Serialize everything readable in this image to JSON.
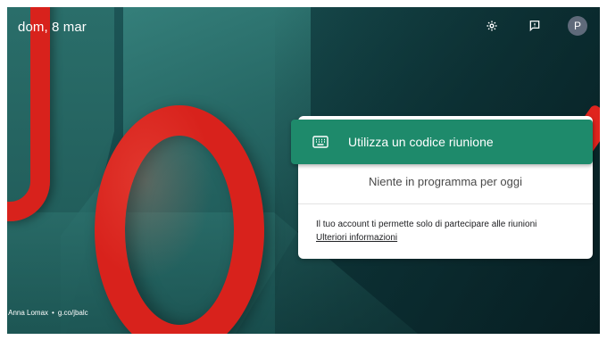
{
  "header": {
    "date": "dom, 8 mar",
    "avatar_letter": "P"
  },
  "icons": {
    "settings": "gear-icon",
    "feedback": "feedback-icon",
    "keyboard": "keyboard-icon"
  },
  "panel": {
    "join_label": "Utilizza un codice riunione",
    "nothing_scheduled": "Niente in programma per oggi",
    "account_info": "Il tuo account ti permette solo di partecipare alle riunioni",
    "more_info_link": "Ulteriori informazioni"
  },
  "credit": {
    "author": "& Anna Lomax",
    "separator": "•",
    "link": "g.co/jbalc"
  },
  "colors": {
    "accent": "#1e8a6b",
    "ring": "#d8221c",
    "avatar_bg": "#5f6a7a"
  }
}
